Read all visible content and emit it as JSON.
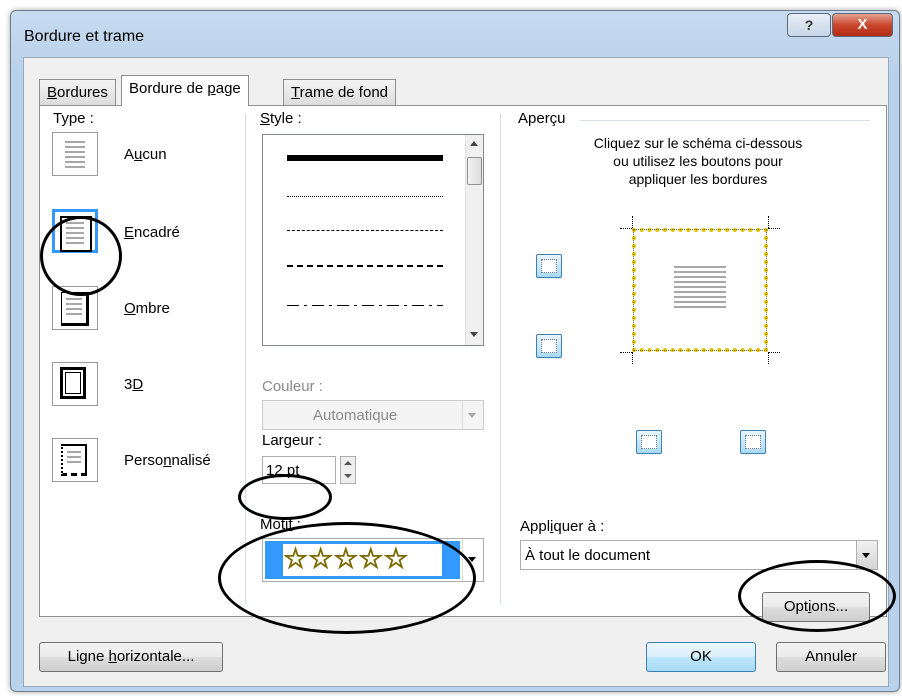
{
  "window": {
    "title": "Bordure et trame",
    "help": "?",
    "close": "X"
  },
  "tabs": [
    {
      "pre": "",
      "ul": "B",
      "post": "ordures"
    },
    {
      "pre": "Bordure de ",
      "ul": "p",
      "post": "age"
    },
    {
      "pre": "",
      "ul": "T",
      "post": "rame de fond"
    }
  ],
  "type": {
    "label": "Type :",
    "items": [
      {
        "pre": "A",
        "ul": "u",
        "post": "cun"
      },
      {
        "pre": "",
        "ul": "E",
        "post": "ncadré"
      },
      {
        "pre": "",
        "ul": "O",
        "post": "mbre"
      },
      {
        "pre": "3",
        "ul": "D",
        "post": ""
      },
      {
        "pre": "Perso",
        "ul": "n",
        "post": "nalisé"
      }
    ]
  },
  "style": {
    "pre": "",
    "ul": "S",
    "post": "tyle :"
  },
  "couleur": {
    "label": "Couleur :",
    "value": "Automatique"
  },
  "largeur": {
    "label": "Largeur :",
    "value": "12 pt"
  },
  "motif": {
    "pre": "Moti",
    "ul": "f",
    "post": " :"
  },
  "apercu": {
    "title": "Aperçu",
    "instructions": [
      "Cliquez sur le schéma ci-dessous",
      "ou utilisez les boutons pour",
      "appliquer les bordures"
    ]
  },
  "appliquer": {
    "pre": "Appl",
    "ul": "i",
    "post": "quer à :",
    "value": "À tout le document"
  },
  "buttons": {
    "options": {
      "pre": "Opt",
      "ul": "i",
      "post": "ons..."
    },
    "ligne": {
      "pre": "Ligne ",
      "ul": "h",
      "post": "orizontale..."
    },
    "ok": "OK",
    "annuler": "Annuler"
  },
  "colors": {
    "accent": "#3399ff",
    "star": "#e3c300",
    "titlebar": "#b9d1ea",
    "close": "#c9452c"
  }
}
